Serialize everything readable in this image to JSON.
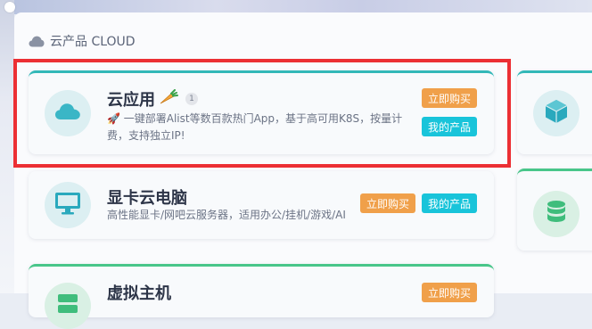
{
  "section": {
    "title": "云产品 CLOUD",
    "icon": "cloud-icon"
  },
  "products": [
    {
      "title": "云应用",
      "title_emoji": "carrot-icon",
      "badge": "1",
      "desc_line1": "🚀 一键部署Alist等数百款热门App，基于高可用K8S，按量计",
      "desc_line2": "费，支持独立IP!",
      "buy_label": "立即购买",
      "my_label": "我的产品",
      "icon": "cloud-icon",
      "accent": "#33b8b8"
    },
    {
      "title": "显卡云电脑",
      "desc_line1": "高性能显卡/网吧云服务器，适用办公/挂机/游戏/AI",
      "buy_label": "立即购买",
      "my_label": "我的产品",
      "icon": "monitor-icon"
    },
    {
      "title": "虚拟主机",
      "buy_label": "立即购买",
      "icon": "server-icon",
      "accent": "#49c68a"
    }
  ],
  "right_cards": [
    {
      "icon": "cube-icon",
      "accent": "#33b8b8"
    },
    {
      "icon": "database-icon",
      "accent": "#49c68a"
    }
  ],
  "colors": {
    "buy": "#f0a04a",
    "my": "#19c4da",
    "highlight": "#ec2f34"
  }
}
